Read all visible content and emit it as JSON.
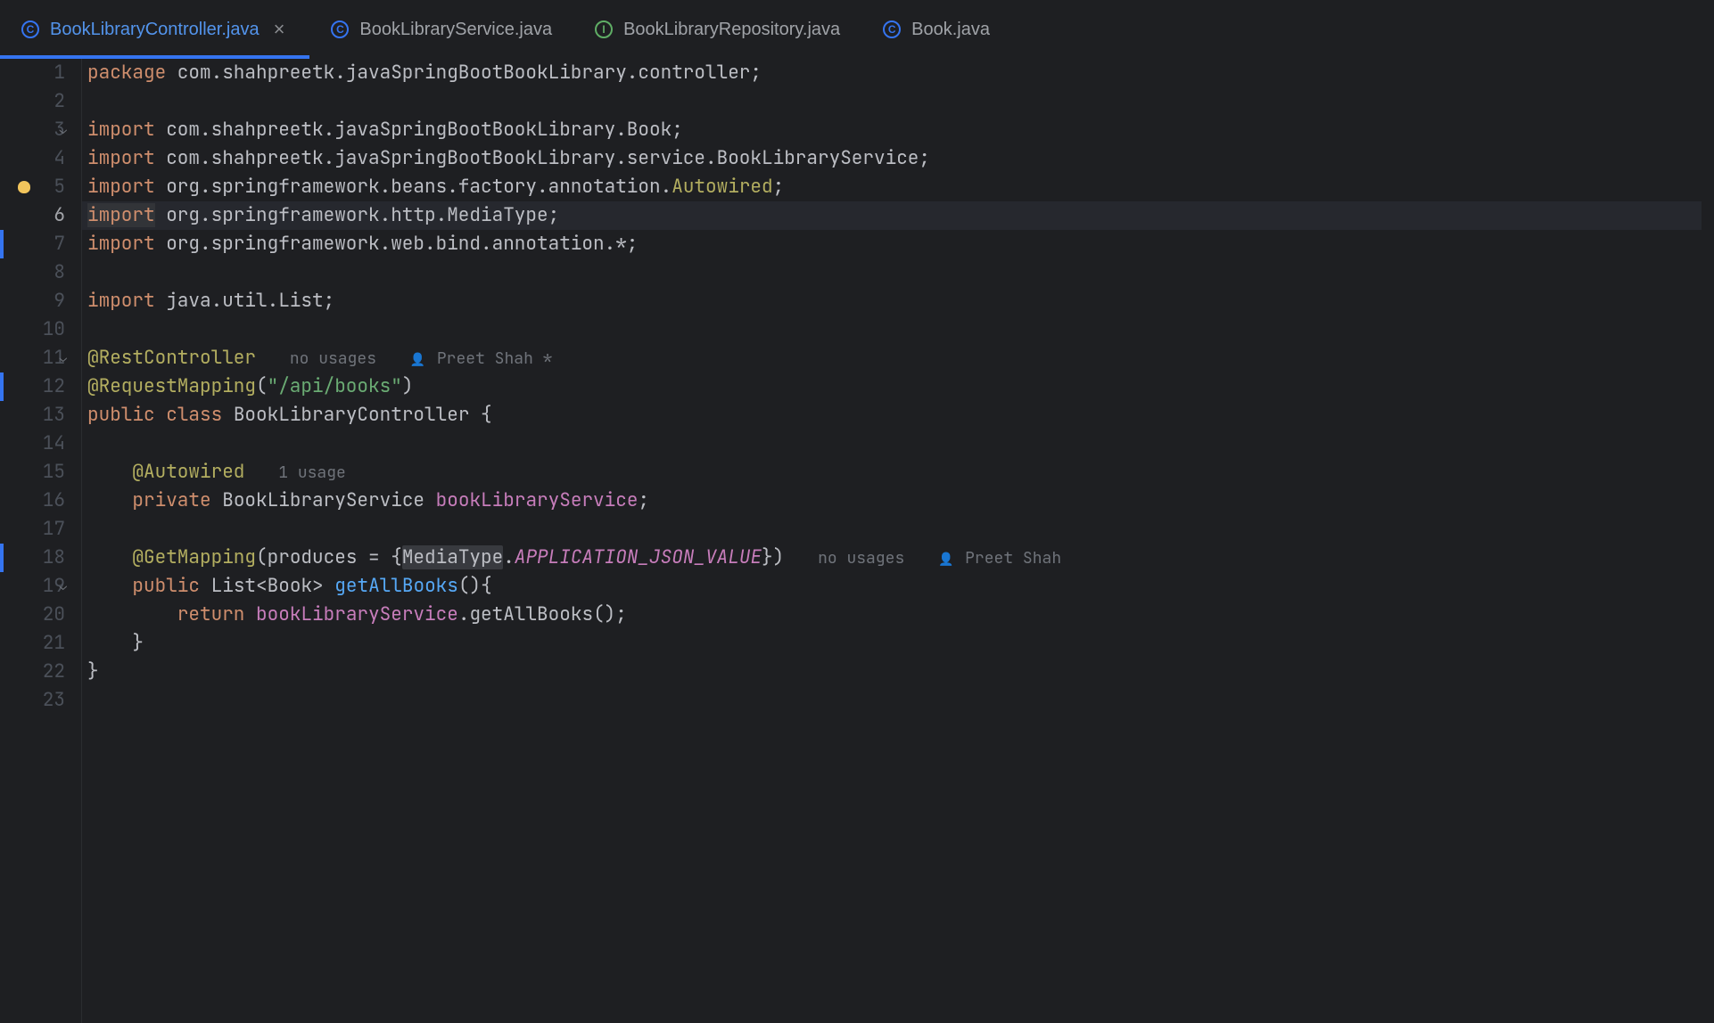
{
  "tabs": [
    {
      "label": "BookLibraryController.java",
      "icon": "C",
      "iconType": "class",
      "active": true,
      "closable": true
    },
    {
      "label": "BookLibraryService.java",
      "icon": "C",
      "iconType": "class",
      "active": false,
      "closable": false
    },
    {
      "label": "BookLibraryRepository.java",
      "icon": "I",
      "iconType": "interface",
      "active": false,
      "closable": false
    },
    {
      "label": "Book.java",
      "icon": "C",
      "iconType": "class",
      "active": false,
      "closable": false
    }
  ],
  "lineNumbers": [
    "1",
    "2",
    "3",
    "4",
    "5",
    "6",
    "7",
    "8",
    "9",
    "10",
    "11",
    "12",
    "13",
    "14",
    "15",
    "16",
    "17",
    "18",
    "19",
    "20",
    "21",
    "22",
    "23"
  ],
  "currentLine": 6,
  "foldLines": [
    3,
    11,
    19
  ],
  "changeMarkerLines": [
    7,
    12,
    18
  ],
  "bulbLine": 5,
  "code": {
    "l1": {
      "kw": "package",
      "rest": " com.shahpreetk.javaSpringBootBookLibrary.controller;"
    },
    "l3": {
      "kw": "import",
      "rest": " com.shahpreetk.javaSpringBootBookLibrary.Book;"
    },
    "l4": {
      "kw": "import",
      "rest": " com.shahpreetk.javaSpringBootBookLibrary.service.BookLibraryService;"
    },
    "l5": {
      "kw": "import",
      "p1": " org.springframework.beans.factory.annotation.",
      "anno": "Autowired",
      "p2": ";"
    },
    "l6": {
      "kw": "import",
      "rest": " org.springframework.http.MediaType;"
    },
    "l7": {
      "kw": "import",
      "rest": " org.springframework.web.bind.annotation.*;"
    },
    "l9": {
      "kw": "import",
      "rest": " java.util.List;"
    },
    "l11": {
      "anno": "@RestController",
      "hint1": "no usages",
      "hint2": "Preet Shah *"
    },
    "l12": {
      "anno": "@RequestMapping",
      "p1": "(",
      "str": "\"/api/books\"",
      "p2": ")"
    },
    "l13": {
      "kw1": "public",
      "kw2": "class",
      "name": "BookLibraryController",
      "brace": "{"
    },
    "l15": {
      "anno": "@Autowired",
      "hint": "1 usage"
    },
    "l16": {
      "kw": "private",
      "type": "BookLibraryService",
      "field": "bookLibraryService",
      "semi": ";"
    },
    "l18": {
      "anno": "@GetMapping",
      "p1": "(produces = {",
      "mt": "MediaType",
      "dot": ".",
      "const": "APPLICATION_JSON_VALUE",
      "p2": "})",
      "hint1": "no usages",
      "hint2": "Preet Shah"
    },
    "l19": {
      "kw": "public",
      "type": "List",
      "lt": "<",
      "inner": "Book",
      "gt": ">",
      "fn": "getAllBooks",
      "paren": "(){"
    },
    "l20": {
      "kw": "return",
      "field": "bookLibraryService",
      "dot": ".",
      "call": "getAllBooks",
      "rest": "();"
    },
    "l21": {
      "brace": "}"
    },
    "l22": {
      "brace": "}"
    }
  }
}
